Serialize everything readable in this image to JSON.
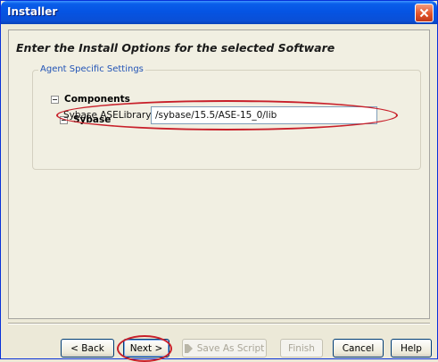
{
  "window": {
    "title": "Installer"
  },
  "page": {
    "heading": "Enter the Install Options for the selected Software",
    "group_label": "Agent Specific Settings",
    "tree": {
      "components_label": "Components",
      "sybase_label": "Sybase"
    },
    "field": {
      "label": "Sybase ASELibrary Path",
      "value": "/sybase/15.5/ASE-15_0/lib"
    }
  },
  "buttons": {
    "back": "< Back",
    "next": "Next >",
    "save_script": "Save As Script",
    "finish": "Finish",
    "cancel": "Cancel",
    "help": "Help"
  },
  "colors": {
    "titlebar": "#0554e3",
    "highlight": "#c8202a",
    "group_label": "#2153b6"
  },
  "icons": {
    "close": "close-icon",
    "collapse": "collapse-icon",
    "script": "script-icon"
  }
}
